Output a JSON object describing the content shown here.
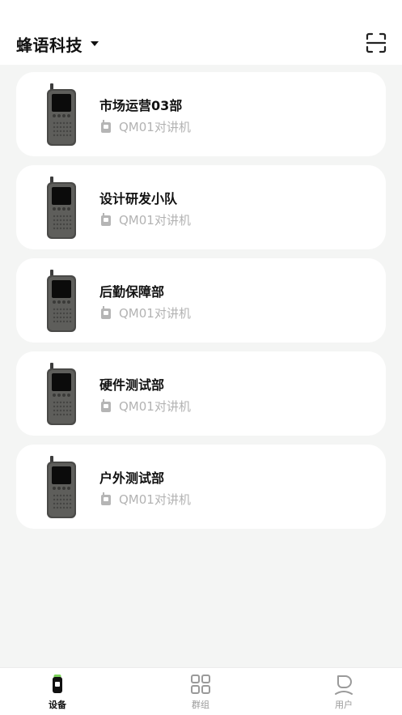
{
  "header": {
    "org_name": "蜂语科技",
    "scan_icon": "scan-icon",
    "dropdown_icon": "caret-down-icon"
  },
  "devices": [
    {
      "name": "市场运营03部",
      "model": "QM01对讲机"
    },
    {
      "name": "设计研发小队",
      "model": "QM01对讲机"
    },
    {
      "name": "后勤保障部",
      "model": "QM01对讲机"
    },
    {
      "name": "硬件测试部",
      "model": "QM01对讲机"
    },
    {
      "name": "户外测试部",
      "model": "QM01对讲机"
    }
  ],
  "tabbar": {
    "items": [
      {
        "label": "设备",
        "icon": "device-icon",
        "active": true
      },
      {
        "label": "群组",
        "icon": "grid-icon",
        "active": false
      },
      {
        "label": "用户",
        "icon": "user-icon",
        "active": false
      }
    ]
  },
  "colors": {
    "background": "#f4f5f4",
    "card": "#ffffff",
    "accent": "#7bd35a",
    "muted_text": "#b3b3b3"
  }
}
